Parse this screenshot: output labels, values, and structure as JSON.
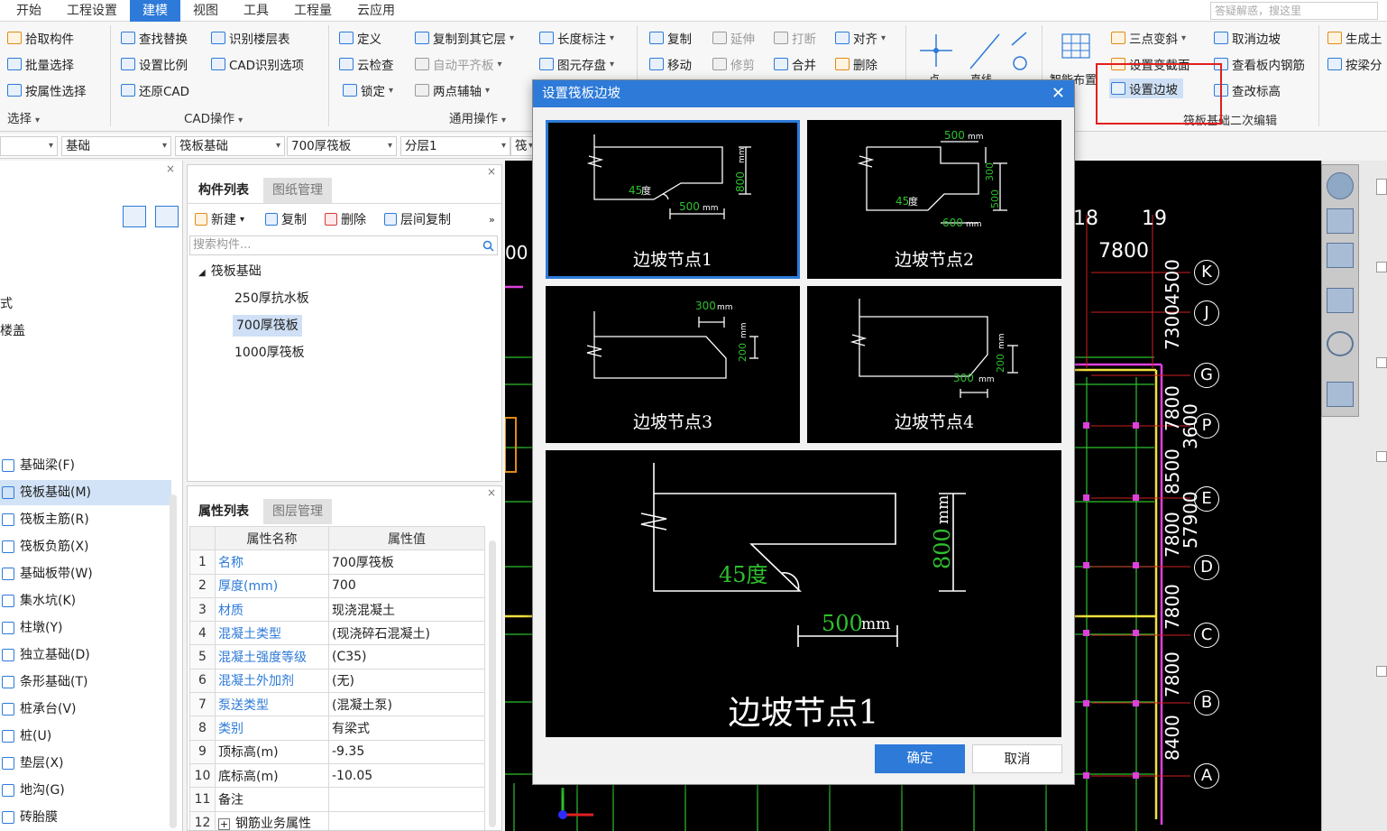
{
  "menu": {
    "items": [
      "开始",
      "工程设置",
      "建模",
      "视图",
      "工具",
      "工程量",
      "云应用"
    ],
    "active_index": 2,
    "search_placeholder": "答疑解惑，搜这里"
  },
  "ribbon": {
    "select": {
      "pick": "拾取构件",
      "batch": "批量选择",
      "by_attr": "按属性选择",
      "label": "选择"
    },
    "cad": {
      "find_replace": "查找替换",
      "identify_floor": "识别楼层表",
      "set_scale": "设置比例",
      "cad_options": "CAD识别选项",
      "restore": "还原CAD",
      "label": "CAD操作"
    },
    "common": {
      "define": "定义",
      "copy_to_floor": "复制到其它层",
      "length_dim": "长度标注",
      "cloud_check": "云检查",
      "auto_flat": "自动平齐板",
      "save_drawing": "图元存盘",
      "lock": "锁定",
      "two_point_aux": "两点辅轴",
      "label": "通用操作"
    },
    "modify": {
      "copy": "复制",
      "extend": "延伸",
      "break": "打断",
      "align": "对齐",
      "move": "移动",
      "trim": "修剪",
      "merge": "合并",
      "delete": "删除"
    },
    "draw": {
      "point": "点",
      "line": "直线"
    },
    "smart": {
      "smart_layout": "智能布置"
    },
    "raft": {
      "three_point_slope": "三点变斜",
      "cancel_slope": "取消边坡",
      "set_section": "设置变截面",
      "view_rebar": "查看板内钢筋",
      "set_slope": "设置边坡",
      "check_elev": "查改标高",
      "label": "筏板基础二次编辑"
    },
    "extra": {
      "generate": "生成土",
      "by_beam": "按梁分"
    }
  },
  "selectors": {
    "s0": "",
    "s1": "基础",
    "s2": "筏板基础",
    "s3": "700厚筏板",
    "s4": "分层1",
    "s5": "筏板"
  },
  "leftnav": {
    "partial_top": [
      "式",
      "楼盖"
    ],
    "items": [
      {
        "label": "基础梁(F)",
        "active": false
      },
      {
        "label": "筏板基础(M)",
        "active": true
      },
      {
        "label": "筏板主筋(R)",
        "active": false
      },
      {
        "label": "筏板负筋(X)",
        "active": false
      },
      {
        "label": "基础板带(W)",
        "active": false
      },
      {
        "label": "集水坑(K)",
        "active": false
      },
      {
        "label": "柱墩(Y)",
        "active": false
      },
      {
        "label": "独立基础(D)",
        "active": false
      },
      {
        "label": "条形基础(T)",
        "active": false
      },
      {
        "label": "桩承台(V)",
        "active": false
      },
      {
        "label": "桩(U)",
        "active": false
      },
      {
        "label": "垫层(X)",
        "active": false
      },
      {
        "label": "地沟(G)",
        "active": false
      },
      {
        "label": "砖胎膜",
        "active": false
      }
    ]
  },
  "components": {
    "tabs": [
      "构件列表",
      "图纸管理"
    ],
    "toolbar": {
      "new": "新建",
      "copy": "复制",
      "delete": "删除",
      "floor_copy": "层间复制"
    },
    "search_placeholder": "搜索构件...",
    "root": "筏板基础",
    "items": [
      "250厚抗水板",
      "700厚筏板",
      "1000厚筏板"
    ],
    "selected": "700厚筏板"
  },
  "properties": {
    "tabs": [
      "属性列表",
      "图层管理"
    ],
    "header": {
      "name": "属性名称",
      "value": "属性值"
    },
    "rows": [
      {
        "n": "1",
        "name": "名称",
        "value": "700厚筏板",
        "link": true
      },
      {
        "n": "2",
        "name": "厚度(mm)",
        "value": "700",
        "link": true
      },
      {
        "n": "3",
        "name": "材质",
        "value": "现浇混凝土",
        "link": true
      },
      {
        "n": "4",
        "name": "混凝土类型",
        "value": "(现浇碎石混凝土)",
        "link": true
      },
      {
        "n": "5",
        "name": "混凝土强度等级",
        "value": "(C35)",
        "link": true
      },
      {
        "n": "6",
        "name": "混凝土外加剂",
        "value": "(无)",
        "link": true
      },
      {
        "n": "7",
        "name": "泵送类型",
        "value": "(混凝土泵)",
        "link": true
      },
      {
        "n": "8",
        "name": "类别",
        "value": "有梁式",
        "link": true
      },
      {
        "n": "9",
        "name": "顶标高(m)",
        "value": "-9.35",
        "link": false
      },
      {
        "n": "10",
        "name": "底标高(m)",
        "value": "-10.05",
        "link": false
      },
      {
        "n": "11",
        "name": "备注",
        "value": "",
        "link": false
      },
      {
        "n": "12",
        "name": "钢筋业务属性",
        "value": "",
        "link": false
      }
    ]
  },
  "cad": {
    "top_axes": [
      "18",
      "19"
    ],
    "top_dim": "7800",
    "top_left_dim": "00",
    "row_axes": [
      "K",
      "J",
      "G",
      "P",
      "E",
      "D",
      "C",
      "B",
      "A"
    ],
    "row_dims": [
      "4500",
      "7300",
      "7800",
      "3600",
      "8500",
      "7800",
      "57900",
      "7800",
      "7800",
      "8400"
    ]
  },
  "dialog": {
    "title": "设置筏板边坡",
    "nodes": [
      {
        "label": "边坡节点1",
        "a": "45",
        "a_unit": "度",
        "w": "500",
        "h": "800"
      },
      {
        "label": "边坡节点2",
        "a": "45",
        "a_unit": "度",
        "w1": "500",
        "w2": "600",
        "h1": "300",
        "h2": "500"
      },
      {
        "label": "边坡节点3",
        "w": "300",
        "h": "200"
      },
      {
        "label": "边坡节点4",
        "w": "300",
        "h": "200"
      }
    ],
    "unit": "mm",
    "preview": {
      "label": "边坡节点1",
      "angle": "45度",
      "width": "500",
      "height": "800",
      "unit": "mm"
    },
    "ok": "确定",
    "cancel": "取消",
    "close_icon": "close-icon"
  }
}
